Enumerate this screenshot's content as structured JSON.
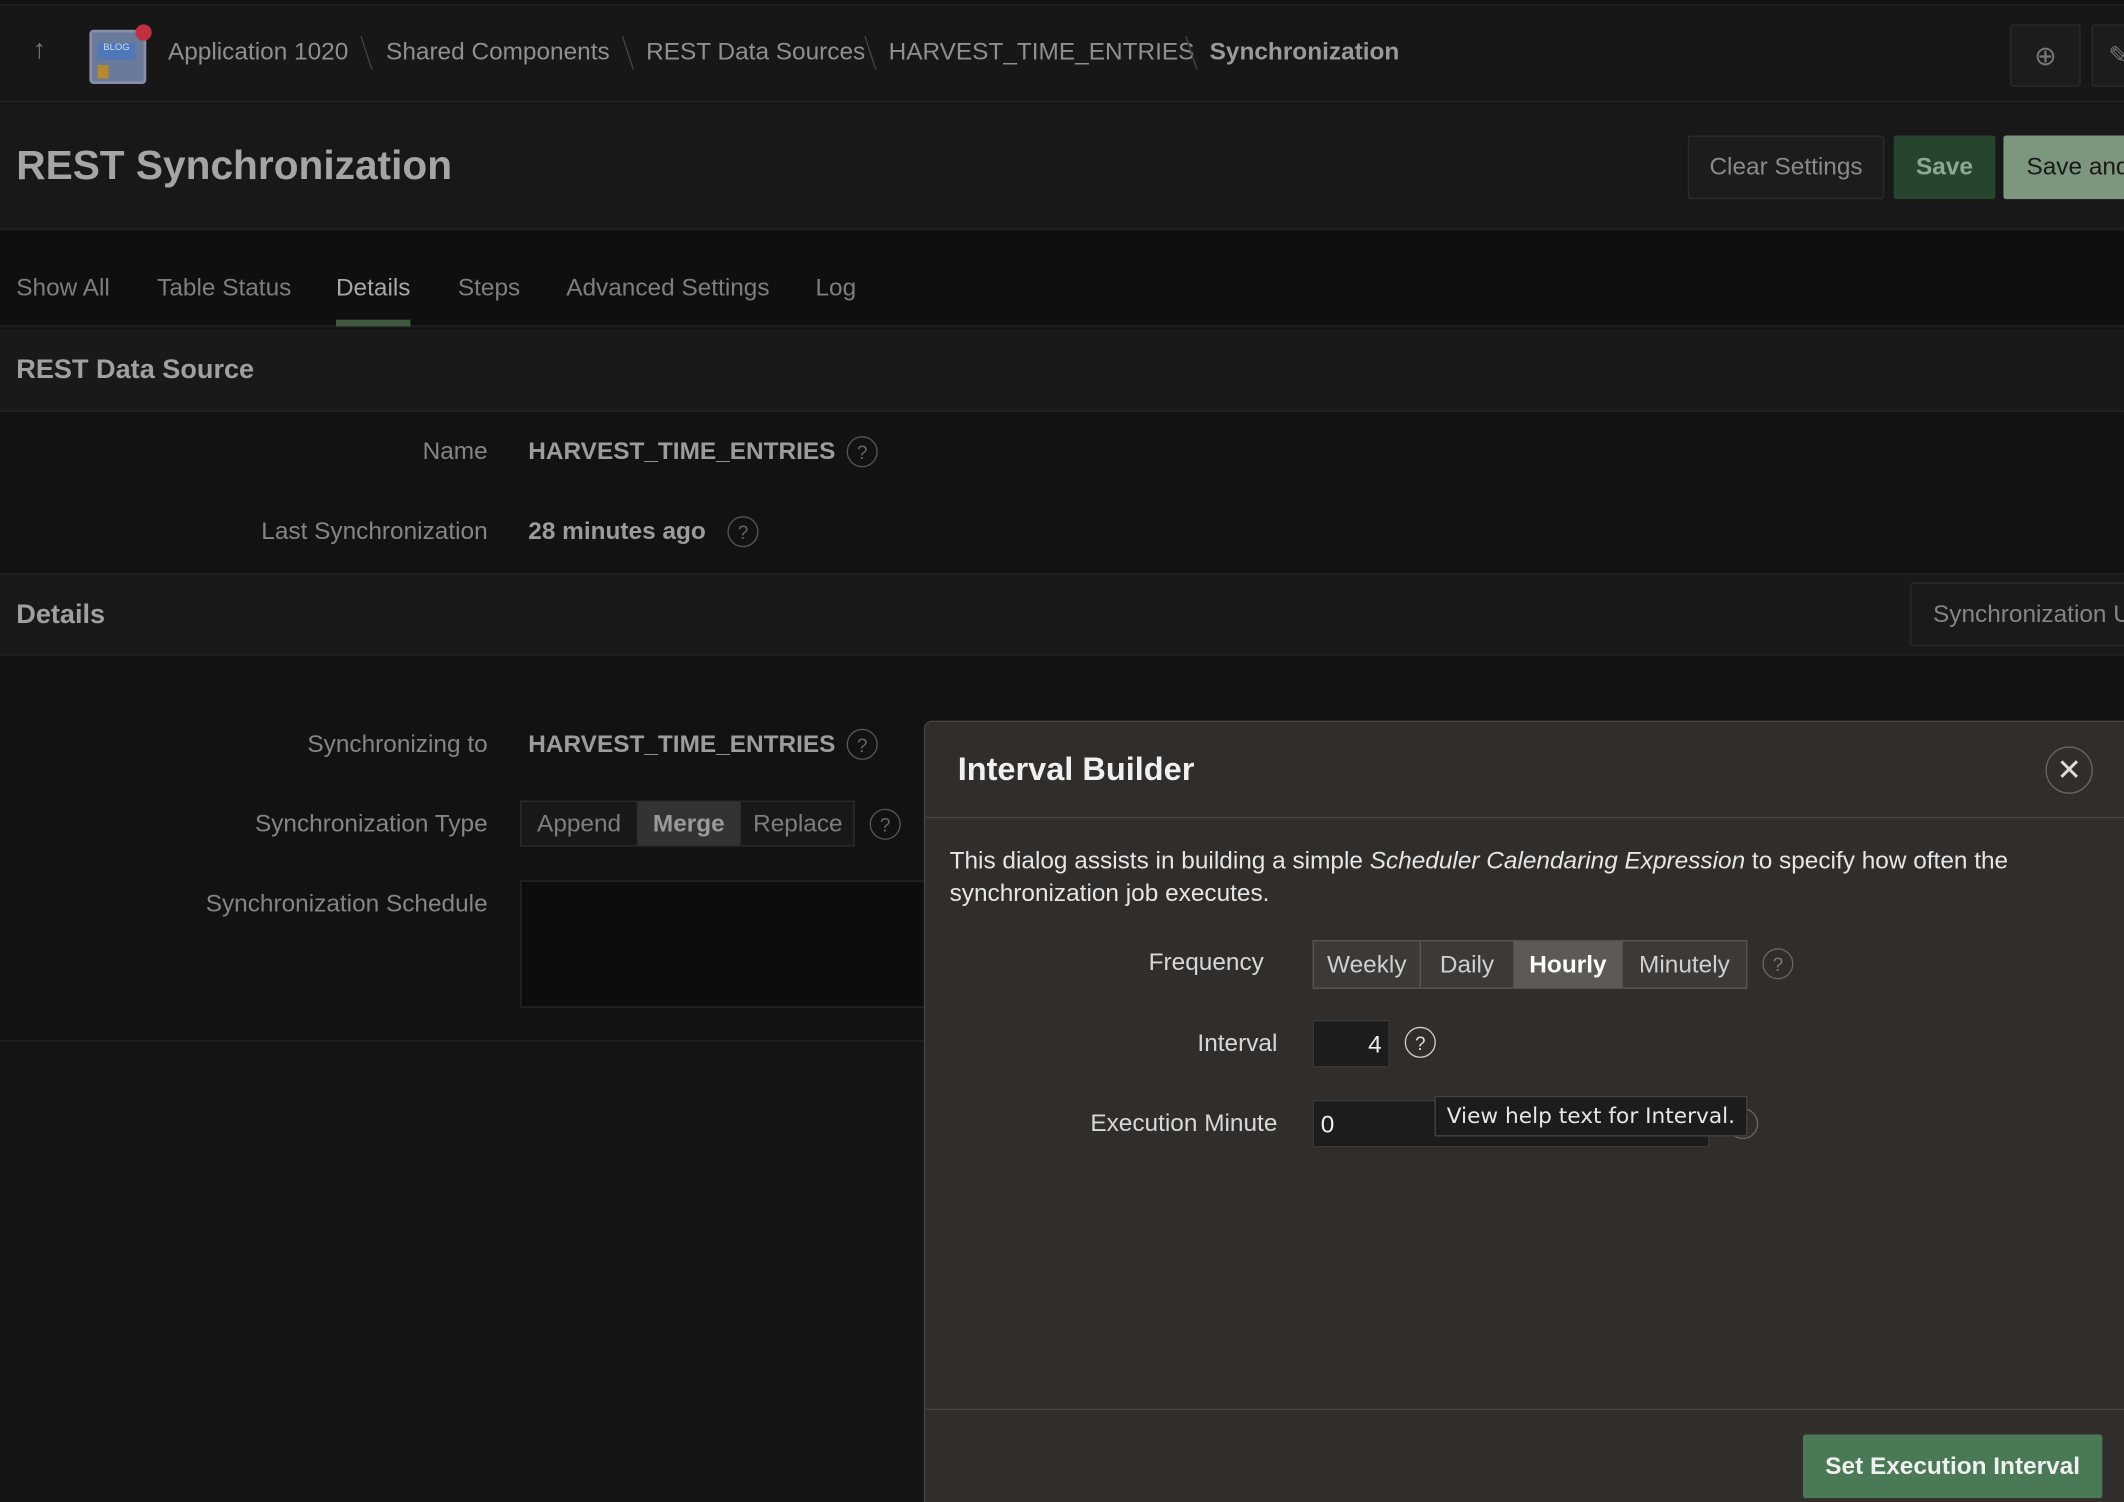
{
  "breadcrumb": {
    "items": [
      "Application 1020",
      "Shared Components",
      "REST Data Sources",
      "HARVEST_TIME_ENTRIES",
      "Synchronization"
    ]
  },
  "icons": {
    "up": "arrow-up-icon",
    "app": "blog-app-icon",
    "feedback": "chat-plus-icon",
    "close": "close-icon",
    "help": "question-circle-icon"
  },
  "header": {
    "title": "REST Synchronization",
    "clear_label": "Clear Settings",
    "save_label": "Save",
    "save_and_label": "Save and"
  },
  "tabs": [
    {
      "label": "Show All"
    },
    {
      "label": "Table Status"
    },
    {
      "label": "Details",
      "active": true
    },
    {
      "label": "Steps"
    },
    {
      "label": "Advanced Settings"
    },
    {
      "label": "Log"
    }
  ],
  "rest_source": {
    "heading": "REST Data Source",
    "name_label": "Name",
    "name_value": "HARVEST_TIME_ENTRIES",
    "last_sync_label": "Last Synchronization",
    "last_sync_value": "28 minutes ago"
  },
  "details": {
    "heading": "Details",
    "button_label": "Synchronization U",
    "sync_to_label": "Synchronizing to",
    "sync_to_value": "HARVEST_TIME_ENTRIES",
    "type_label": "Synchronization Type",
    "type_options": [
      "Append",
      "Merge",
      "Replace"
    ],
    "type_selected": "Merge",
    "schedule_label": "Synchronization Schedule"
  },
  "dialog": {
    "title": "Interval Builder",
    "intro_before": "This dialog assists in building a simple ",
    "intro_em": "Scheduler Calendaring Expression",
    "intro_after": " to specify how often the synchronization job executes.",
    "frequency_label": "Frequency",
    "frequency_options": [
      "Weekly",
      "Daily",
      "Hourly",
      "Minutely"
    ],
    "frequency_selected": "Hourly",
    "interval_label": "Interval",
    "interval_value": "4",
    "minute_label": "Execution Minute",
    "minute_value": "0",
    "tooltip": "View help text for Interval.",
    "submit_label": "Set Execution Interval"
  },
  "colors": {
    "accent_green": "#4a7a55",
    "save_green": "#27452e",
    "active_tab_underline": "#3f5a3f"
  }
}
